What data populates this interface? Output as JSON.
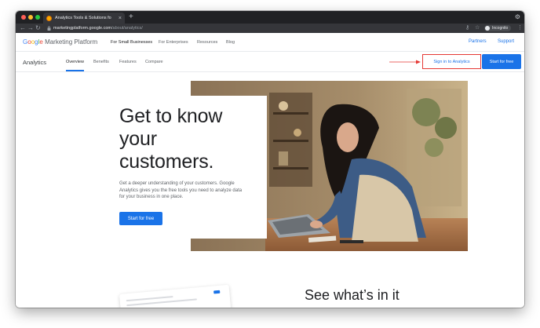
{
  "browser": {
    "tab_title": "Analytics Tools & Solutions fo",
    "tab_close_icon": "×",
    "new_tab_icon": "+",
    "url_host": "marketingplatform.google.com",
    "url_path": "/about/analytics/",
    "incognito_label": "Incognito",
    "icons": [
      "back-icon",
      "forward-icon",
      "reload-icon",
      "lock-icon",
      "key-icon",
      "star-icon",
      "incognito-icon",
      "menu-icon",
      "settings-icon"
    ]
  },
  "gmp_header": {
    "logo_letters": [
      "G",
      "o",
      "o",
      "g",
      "l",
      "e"
    ],
    "product": "Marketing Platform",
    "nav": [
      "For Small Businesses",
      "For Enterprises",
      "Resources",
      "Blog"
    ],
    "right_links": [
      "Partners",
      "Support"
    ]
  },
  "sub_header": {
    "product_name": "Analytics",
    "tabs": [
      "Overview",
      "Benefits",
      "Features",
      "Compare"
    ],
    "active_tab": "Overview",
    "sign_in_label": "Sign in to Analytics",
    "start_label": "Start for free"
  },
  "hero": {
    "headline_lines": [
      "Get to know",
      "your",
      "customers."
    ],
    "body_lines": [
      "Get a deeper understanding of your customers. Google",
      "Analytics gives you the free tools you need to analyze data",
      "for your business in one place."
    ],
    "cta_label": "Start for free"
  },
  "section": {
    "title": "See what’s in it"
  },
  "colors": {
    "accent": "#1a73e8",
    "highlight_box": "#e53935",
    "chrome_dark": "#202124"
  }
}
